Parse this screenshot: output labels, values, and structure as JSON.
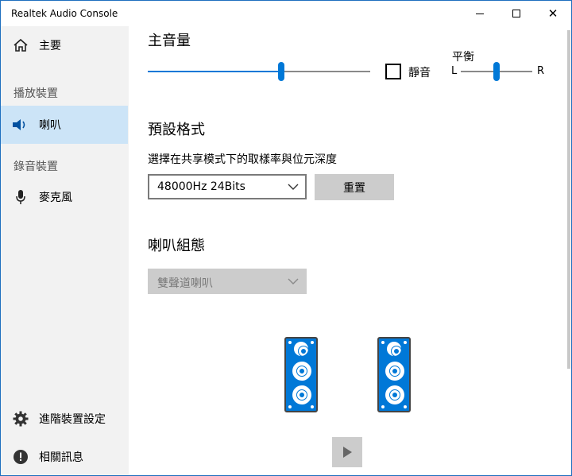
{
  "window": {
    "title": "Realtek Audio Console",
    "minimize_glyph": "",
    "maximize_glyph": "",
    "close_glyph": "✕"
  },
  "sidebar": {
    "home": {
      "label": "主要",
      "icon": "home-icon"
    },
    "playback_header": "播放裝置",
    "speaker": {
      "label": "喇叭",
      "icon": "speaker-icon",
      "selected": true
    },
    "recording_header": "錄音裝置",
    "microphone": {
      "label": "麥克風",
      "icon": "microphone-icon"
    },
    "advanced": {
      "label": "進階裝置設定",
      "icon": "gear-icon"
    },
    "info": {
      "label": "相關訊息",
      "icon": "info-icon"
    }
  },
  "main": {
    "volume": {
      "title": "主音量",
      "level": 0.6,
      "mute_label": "靜音",
      "muted": false
    },
    "balance": {
      "title": "平衡",
      "left_label": "L",
      "right_label": "R",
      "position": 0.5
    },
    "default_format": {
      "title": "預設格式",
      "description": "選擇在共享模式下的取樣率與位元深度",
      "selected": "48000Hz 24Bits",
      "reset_label": "重置"
    },
    "speaker_config": {
      "title": "喇叭組態",
      "selected": "雙聲道喇叭",
      "enabled": false
    }
  },
  "colors": {
    "accent": "#0078d7",
    "selected_bg": "#cce4f7",
    "sidebar_bg": "#f2f2f2",
    "disabled": "#cccccc"
  }
}
